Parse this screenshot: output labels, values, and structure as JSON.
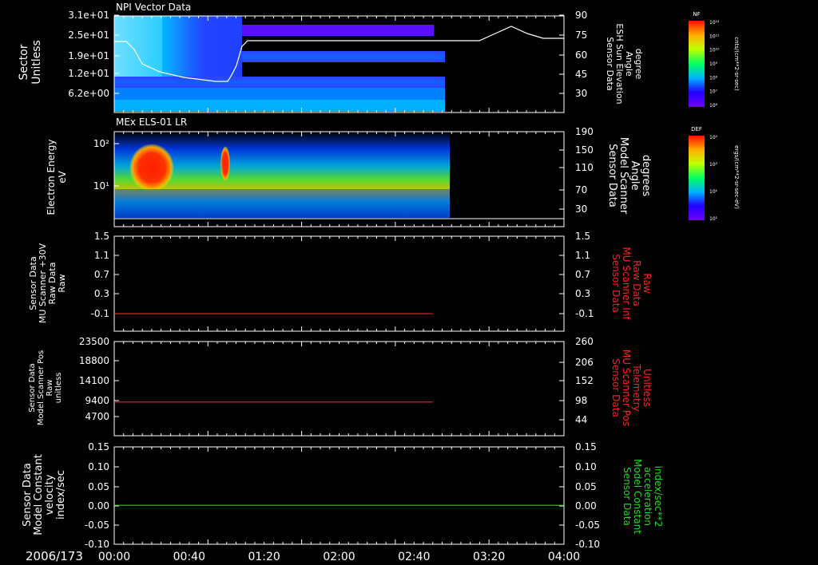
{
  "date": "2006/173",
  "time_ticks": [
    "00:00",
    "00:40",
    "01:20",
    "02:00",
    "02:40",
    "03:20",
    "04:00"
  ],
  "colors": {
    "background": "#000000",
    "frame": "#ffffff",
    "red_trace": "#ff2020",
    "green_trace": "#22dd22",
    "white_trace": "#ffffff"
  },
  "chart_data": [
    {
      "type": "heatmap",
      "title": "NPI Vector Data",
      "ylabel": [
        "Sector",
        "Unitless"
      ],
      "yticks": [
        "3.1e+01",
        "2.5e+01",
        "1.9e+01",
        "1.2e+01",
        "6.2e+00"
      ],
      "ylabel_right": [
        "Sensor Data",
        "ESH Sun Elevation",
        "Angle",
        "degree"
      ],
      "yticks_right": [
        "90",
        "75",
        "60",
        "45",
        "30"
      ],
      "colorbar": {
        "title": "NF",
        "ticks": [
          "10¹²",
          "10¹¹",
          "10¹⁰",
          "10⁹",
          "10⁸",
          "10⁷",
          "10⁶"
        ],
        "unit": "cnts/(cm**2-sr-sec)"
      }
    },
    {
      "type": "heatmap",
      "title": "MEx ELS-01 LR",
      "ylabel": [
        "Electron Energy",
        "eV"
      ],
      "yticks": [
        "10²",
        "10¹"
      ],
      "ylabel_right": [
        "Sensor Data",
        "Model Scanner",
        "Angle",
        "degrees"
      ],
      "yticks_right": [
        "190",
        "150",
        "110",
        "70",
        "30"
      ],
      "colorbar": {
        "title": "DEF",
        "ticks": [
          "10⁴",
          "10³",
          "10²",
          "10¹"
        ],
        "unit": "ergs/(cm**2-sr-sec-eV)"
      }
    },
    {
      "type": "line",
      "ylabel": [
        "Sensor Data",
        "MU Scanner +30V",
        "Raw Data",
        "Raw"
      ],
      "yticks": [
        "1.5",
        "1.1",
        "0.7",
        "0.3",
        "-0.1"
      ],
      "ylabel_right": [
        "Sensor Data",
        "MU Scanner Inf",
        "Raw Data",
        "Raw"
      ],
      "yticks_right": [
        "1.5",
        "1.1",
        "0.7",
        "0.3",
        "-0.1"
      ],
      "ylim": [
        -0.4,
        1.5
      ],
      "series": [
        {
          "x": [
            "00:00",
            "02:50"
          ],
          "y": [
            -0.05,
            -0.05
          ]
        }
      ]
    },
    {
      "type": "line",
      "ylabel": [
        "Sensor Data",
        "Model Scanner Pos",
        "Raw",
        "unitless"
      ],
      "yticks": [
        "23500",
        "18800",
        "14100",
        "9400",
        "4700"
      ],
      "ylabel_right": [
        "Sensor Data",
        "MU Scanner Pos",
        "Telemetry",
        "Unitless"
      ],
      "yticks_right": [
        "260",
        "206",
        "152",
        "98",
        "44"
      ],
      "ylim": [
        0,
        23500
      ],
      "series": [
        {
          "x": [
            "00:00",
            "02:50"
          ],
          "y": [
            8400,
            8400
          ]
        }
      ]
    },
    {
      "type": "line",
      "ylabel": [
        "Sensor Data",
        "Model Constant",
        "velocity",
        "index/sec"
      ],
      "yticks": [
        "0.15",
        "0.10",
        "0.05",
        "0.00",
        "-0.05",
        "-0.10"
      ],
      "ylabel_right": [
        "Sensor Data",
        "Model Constant",
        "acceleration",
        "index/sec**2"
      ],
      "yticks_right": [
        "0.15",
        "0.10",
        "0.05",
        "0.00",
        "-0.05",
        "-0.10"
      ],
      "ylim": [
        -0.1,
        0.15
      ],
      "series": [
        {
          "x": [
            "00:00",
            "04:00"
          ],
          "y": [
            0,
            0
          ]
        }
      ]
    }
  ]
}
